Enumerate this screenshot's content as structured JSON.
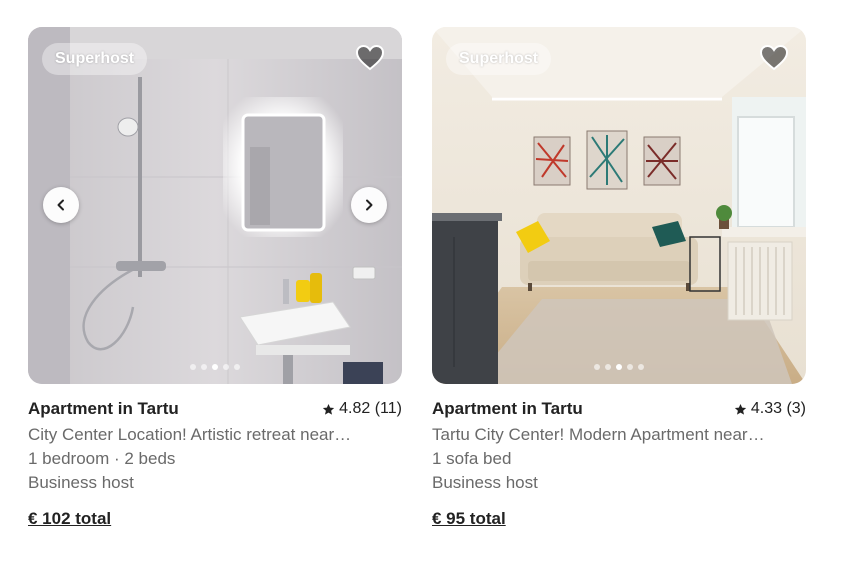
{
  "listings": [
    {
      "badge": "Superhost",
      "title": "Apartment in Tartu",
      "rating": "4.82 (11)",
      "description": "City Center Location! Artistic retreat near…",
      "beds": "1 bedroom · 2 beds",
      "host": "Business host",
      "price": "€ 102 total",
      "photo_count": 5,
      "active_photo": 3,
      "icons": [
        "heart-icon",
        "star-icon",
        "chevron-left-icon",
        "chevron-right-icon"
      ]
    },
    {
      "badge": "Superhost",
      "title": "Apartment in Tartu",
      "rating": "4.33 (3)",
      "description": "Tartu City Center! Modern Apartment near…",
      "beds": "1 sofa bed",
      "host": "Business host",
      "price": "€ 95 total",
      "photo_count": 5,
      "active_photo": 3,
      "icons": [
        "heart-icon",
        "star-icon"
      ]
    }
  ],
  "colors": {
    "text_primary": "#222222",
    "text_secondary": "#6a6a6a",
    "accent_yellow": "#f2cc12"
  }
}
